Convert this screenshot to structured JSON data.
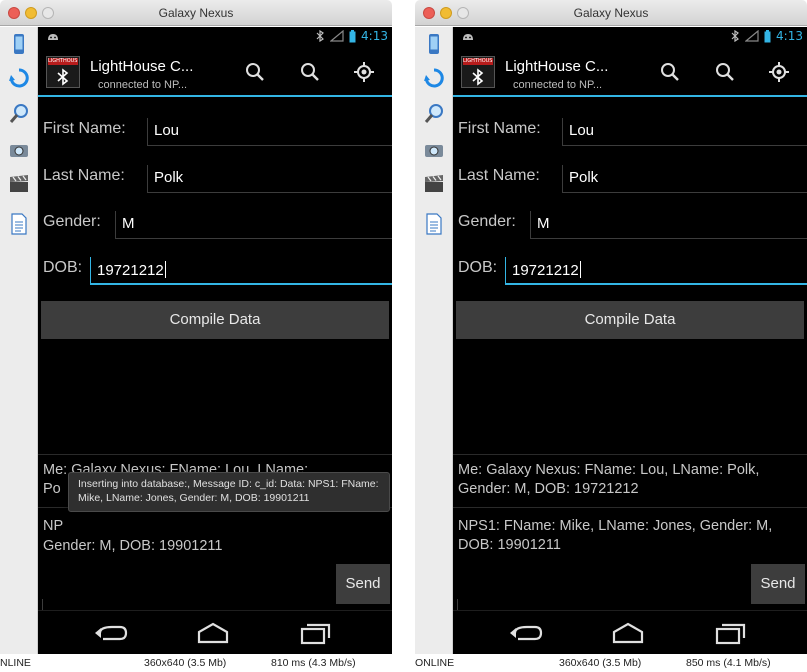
{
  "window_title": "Galaxy Nexus",
  "status": {
    "time": "4:13"
  },
  "action_bar": {
    "brand": "LIGHTHOUSE",
    "title": "LightHouse C...",
    "subtitle": "connected to NP..."
  },
  "fields": {
    "first_name": {
      "label": "First Name:",
      "value": "Lou"
    },
    "last_name": {
      "label": "Last Name:",
      "value": "Polk"
    },
    "gender": {
      "label": "Gender:",
      "value": "M"
    },
    "dob": {
      "label": "DOB:",
      "value": "19721212"
    }
  },
  "compile_label": "Compile Data",
  "send_label": "Send",
  "messages": [
    "Me: Galaxy Nexus: FName: Lou, LName: Polk, Gender: M, DOB: 19721212",
    "NPS1:  FName: Mike, LName: Jones, Gender: M, DOB: 19901211"
  ],
  "left_messages_partial": {
    "line1": "Me: Galaxy Nexus: FName: Lou, LName:",
    "line2": "Po",
    "line3": "NP",
    "line4": "Gender: M, DOB: 19901211"
  },
  "toast": "Inserting into database:, Message ID: c_id: Data: NPS1: FName: Mike, LName: Jones, Gender: M, DOB: 19901211",
  "windows": [
    {
      "online": "NLINE",
      "resolution": "360x640 (3.5 Mb)",
      "timing": "810 ms (4.3 Mb/s)"
    },
    {
      "online": "ONLINE",
      "resolution": "360x640 (3.5 Mb)",
      "timing": "850 ms (4.1 Mb/s)"
    }
  ],
  "colors": {
    "accent": "#33b5e5",
    "background": "#000000",
    "button": "#3d3d3d"
  }
}
